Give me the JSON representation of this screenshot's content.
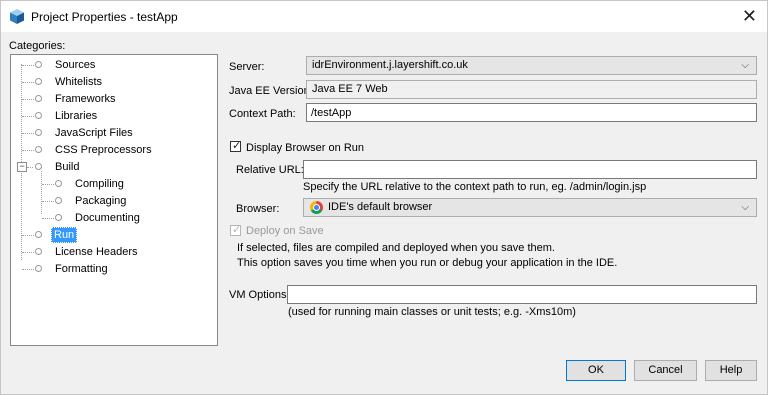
{
  "window": {
    "title": "Project Properties - testApp",
    "close": "✕"
  },
  "categories": {
    "label": "Categories:",
    "items": [
      {
        "label": "Sources"
      },
      {
        "label": "Whitelists"
      },
      {
        "label": "Frameworks"
      },
      {
        "label": "Libraries"
      },
      {
        "label": "JavaScript Files"
      },
      {
        "label": "CSS Preprocessors"
      },
      {
        "label": "Build"
      },
      {
        "label": "Compiling"
      },
      {
        "label": "Packaging"
      },
      {
        "label": "Documenting"
      },
      {
        "label": "Run",
        "selected": true
      },
      {
        "label": "License Headers"
      },
      {
        "label": "Formatting"
      }
    ]
  },
  "form": {
    "server_label": "Server:",
    "server_value": "idrEnvironment.j.layershift.co.uk",
    "javaee_label": "Java EE Version:",
    "javaee_value": "Java EE 7 Web",
    "context_label": "Context Path:",
    "context_value": "/testApp",
    "display_browser_label": "Display Browser on Run",
    "display_browser_checked": true,
    "relative_url_label": "Relative URL:",
    "relative_url_value": "",
    "relative_url_hint": "Specify the URL relative to the context path to run, eg. /admin/login.jsp",
    "browser_label": "Browser:",
    "browser_value": "IDE's default browser",
    "browser_icon": "chrome-icon",
    "deploy_label": "Deploy on Save",
    "deploy_checked": true,
    "deploy_disabled": true,
    "deploy_desc_1": "If selected, files are compiled and deployed when you save them.",
    "deploy_desc_2": "This option saves you time when you run or debug your application in the IDE.",
    "vm_label": "VM Options:",
    "vm_value": "",
    "vm_hint": "(used for running main classes or unit tests; e.g. -Xms10m)"
  },
  "buttons": {
    "ok": "OK",
    "cancel": "Cancel",
    "help": "Help"
  }
}
